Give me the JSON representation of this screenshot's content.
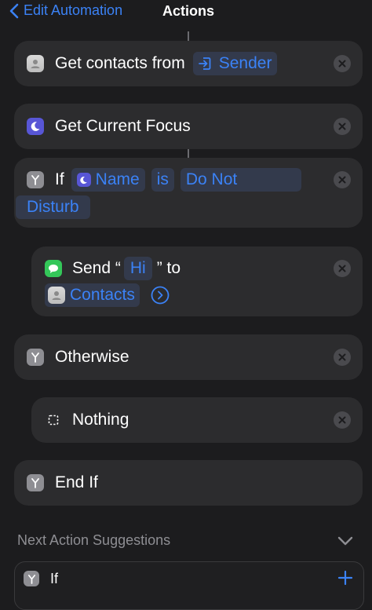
{
  "nav": {
    "back_label": "Edit Automation",
    "title": "Actions"
  },
  "actions": {
    "get_contacts": {
      "label": "Get contacts from",
      "token": "Sender",
      "icon": "contacts-icon"
    },
    "get_focus": {
      "label": "Get Current Focus",
      "icon": "moon-icon"
    },
    "if_block": {
      "keyword": "If",
      "token_name": "Name",
      "operator": "is",
      "value_line1": "Do Not",
      "value_line2": "Disturb"
    },
    "send": {
      "label_prefix": "Send “",
      "message": "Hi",
      "label_mid": "” to",
      "recipient": "Contacts"
    },
    "otherwise": {
      "label": "Otherwise"
    },
    "nothing": {
      "label": "Nothing"
    },
    "end_if": {
      "label": "End If"
    }
  },
  "suggestions": {
    "title": "Next Action Suggestions",
    "items": [
      {
        "label": "If"
      }
    ]
  },
  "colors": {
    "accent": "#3b82f6",
    "card": "#2c2c2e",
    "background": "#1c1c1e"
  }
}
